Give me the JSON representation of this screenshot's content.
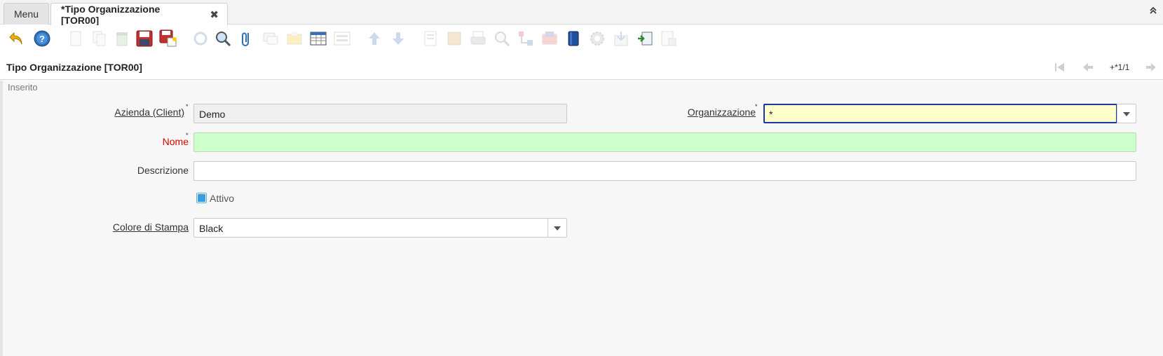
{
  "tabs": {
    "menu_label": "Menu",
    "active_label": "*Tipo Organizzazione [TOR00]",
    "close_glyph": "✖",
    "collapse_glyph": "⌃"
  },
  "toolbar": {
    "icons": [
      "undo-icon",
      "help-icon",
      "new-record-icon",
      "copy-record-icon",
      "delete-icon",
      "save-icon",
      "save-and-new-icon",
      "refresh-icon",
      "find-icon",
      "attachment-icon",
      "chat-icon",
      "product-info-icon",
      "grid-toggle-icon",
      "form-toggle-icon",
      "previous-record-icon",
      "next-record-icon",
      "report-icon",
      "archive-icon",
      "print-icon",
      "zoom-across-icon",
      "active-workflows-icon",
      "requests-icon",
      "quick-form-icon",
      "process-icon",
      "export-icon",
      "import-icon",
      "customize-icon"
    ]
  },
  "header": {
    "title": "Tipo Organizzazione [TOR00]",
    "record_counter": "+*1/1"
  },
  "form": {
    "status": "Inserito",
    "client_label": "Azienda (Client)",
    "client_value": "Demo",
    "org_label": "Organizzazione",
    "org_value": "*",
    "name_label": "Nome",
    "name_value": "",
    "description_label": "Descrizione",
    "description_value": "",
    "active_label": "Attivo",
    "active_checked": true,
    "print_color_label": "Colore di Stampa",
    "print_color_value": "Black",
    "mandatory_marker": "*"
  },
  "colors": {
    "mandatory_bg": "#ccffcc",
    "focused_bg": "#ffffcc",
    "focus_border": "#1a35a8",
    "required_label": "#d80000"
  }
}
